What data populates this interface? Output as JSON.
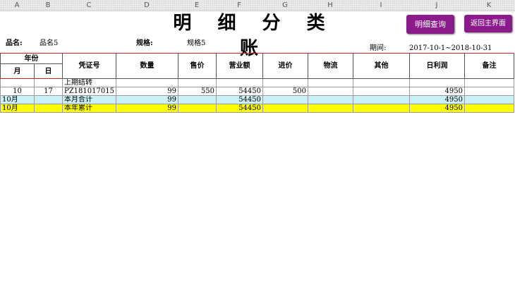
{
  "sheet": {
    "column_letters": [
      "A",
      "B",
      "C",
      "D",
      "E",
      "F",
      "G",
      "H",
      "I",
      "J",
      "K"
    ]
  },
  "title": "明 细 分 类 账",
  "buttons": {
    "detail_query": "明细查询",
    "back_main": "返回主界面"
  },
  "info": {
    "product_label": "品名:",
    "product_value": "品名5",
    "spec_label": "规格:",
    "spec_value": "规格5",
    "period_label": "期间:",
    "period_value": "2017-10-1~2018-10-31"
  },
  "table": {
    "headers": {
      "year_month": "年份",
      "month": "月",
      "day": "日",
      "voucher": "凭证号",
      "quantity": "数量",
      "sale_price": "售价",
      "revenue": "营业额",
      "purchase_price": "进价",
      "logistics": "物流",
      "other": "其他",
      "daily_profit": "日利润",
      "remarks": "备注"
    },
    "rows": [
      {
        "month": "",
        "day": "",
        "voucher": "上期结转",
        "quantity": "",
        "sale_price": "",
        "revenue": "",
        "purchase_price": "",
        "logistics": "",
        "other": "",
        "daily_profit": "",
        "remarks": ""
      },
      {
        "month": "10",
        "day": "17",
        "voucher": "PZ181017015",
        "quantity": "99",
        "sale_price": "550",
        "revenue": "54450",
        "purchase_price": "500",
        "logistics": "",
        "other": "",
        "daily_profit": "4950",
        "remarks": ""
      },
      {
        "month": "10月",
        "day": "",
        "voucher": "本月合计",
        "quantity": "99",
        "sale_price": "",
        "revenue": "54450",
        "purchase_price": "",
        "logistics": "",
        "other": "",
        "daily_profit": "4950",
        "remarks": ""
      },
      {
        "month": "10月",
        "day": "",
        "voucher": "本年累计",
        "quantity": "99",
        "sale_price": "",
        "revenue": "54450",
        "purchase_price": "",
        "logistics": "",
        "other": "",
        "daily_profit": "4950",
        "remarks": ""
      }
    ]
  }
}
